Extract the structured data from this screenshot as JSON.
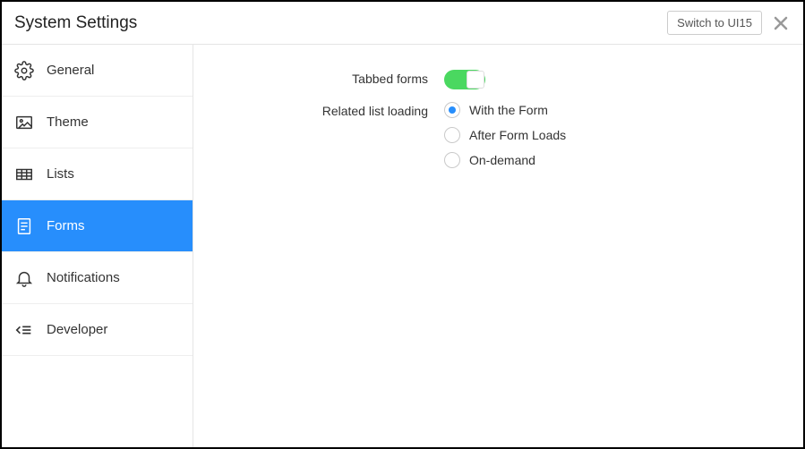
{
  "header": {
    "title": "System Settings",
    "switch_label": "Switch to UI15"
  },
  "sidebar": {
    "items": [
      {
        "label": "General"
      },
      {
        "label": "Theme"
      },
      {
        "label": "Lists"
      },
      {
        "label": "Forms"
      },
      {
        "label": "Notifications"
      },
      {
        "label": "Developer"
      }
    ],
    "active_index": 3
  },
  "content": {
    "tabbed_forms": {
      "label": "Tabbed forms",
      "enabled": true
    },
    "related_list_loading": {
      "label": "Related list loading",
      "options": [
        {
          "label": "With the Form"
        },
        {
          "label": "After Form Loads"
        },
        {
          "label": "On-demand"
        }
      ],
      "selected_index": 0
    }
  }
}
